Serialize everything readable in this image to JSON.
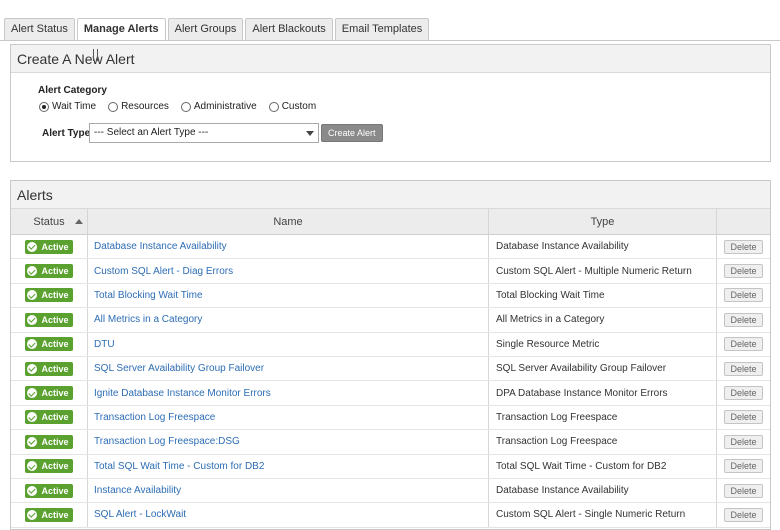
{
  "tabs": [
    "Alert Status",
    "Manage Alerts",
    "Alert Groups",
    "Alert Blackouts",
    "Email Templates"
  ],
  "active_tab": 1,
  "create": {
    "title": "Create A New Alert",
    "category_label": "Alert Category",
    "categories": [
      "Wait Time",
      "Resources",
      "Administrative",
      "Custom"
    ],
    "selected_category": 0,
    "type_label": "Alert Type:",
    "type_value": "--- Select an Alert Type ---",
    "create_button": "Create Alert"
  },
  "alerts": {
    "title": "Alerts",
    "headers": {
      "status": "Status",
      "name": "Name",
      "type": "Type"
    },
    "delete_label": "Delete",
    "rows": [
      {
        "status": "Active",
        "name": "Database Instance Availability",
        "type": "Database Instance Availability"
      },
      {
        "status": "Active",
        "name": "Custom SQL Alert - Diag Errors",
        "type": "Custom SQL Alert - Multiple Numeric Return"
      },
      {
        "status": "Active",
        "name": "Total Blocking Wait Time",
        "type": "Total Blocking Wait Time"
      },
      {
        "status": "Active",
        "name": "All Metrics in a Category",
        "type": "All Metrics in a Category"
      },
      {
        "status": "Active",
        "name": "DTU",
        "type": "Single Resource Metric"
      },
      {
        "status": "Active",
        "name": "SQL Server Availability Group Failover",
        "type": "SQL Server Availability Group Failover"
      },
      {
        "status": "Active",
        "name": "Ignite Database Instance Monitor Errors",
        "type": "DPA Database Instance Monitor Errors"
      },
      {
        "status": "Active",
        "name": "Transaction Log Freespace",
        "type": "Transaction Log Freespace"
      },
      {
        "status": "Active",
        "name": "Transaction Log Freespace:DSG",
        "type": "Transaction Log Freespace"
      },
      {
        "status": "Active",
        "name": "Total SQL Wait Time - Custom for DB2",
        "type": "Total SQL Wait Time - Custom for DB2"
      },
      {
        "status": "Active",
        "name": "Instance Availability",
        "type": "Database Instance Availability"
      },
      {
        "status": "Active",
        "name": "SQL Alert - LockWait",
        "type": "Custom SQL Alert - Single Numeric Return"
      }
    ]
  }
}
